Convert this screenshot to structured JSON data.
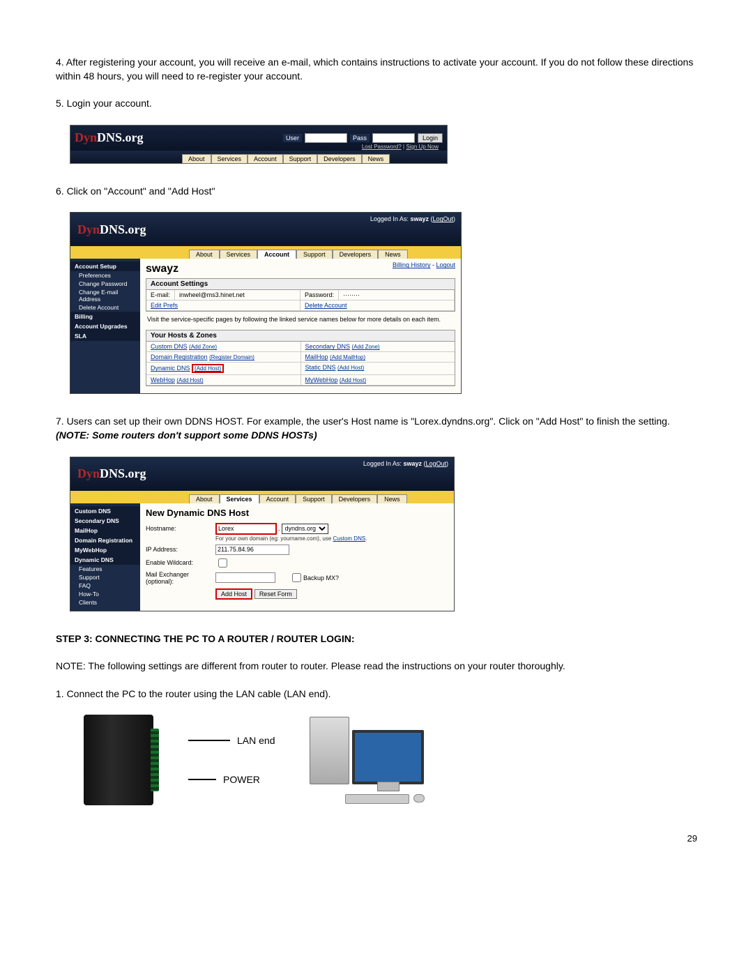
{
  "instructions": {
    "step4": "4. After registering your account, you will receive an e-mail, which contains instructions to activate your account. If you do not follow these directions within 48 hours, you will need to re-register your account.",
    "step5": "5. Login your account.",
    "step6": "6. Click on \"Account\" and \"Add Host\"",
    "step7_a": "7. Users can set up their own DDNS HOST. For example, the user's Host name is \"Lorex.dyndns.org\". Click on \"Add Host\"  to finish the setting. ",
    "step7_note": "(NOTE: Some  routers don't support some DDNS HOSTs)",
    "step3_heading": "STEP 3: CONNECTING THE PC TO A ROUTER / ROUTER LOGIN:",
    "step3_note": "NOTE: The following settings are different from router to router.  Please read the instructions on your router thoroughly.",
    "step3_1": "1. Connect the PC to the router using the LAN cable (LAN end)."
  },
  "logo": {
    "prefix": "Dyn",
    "suffix": "DNS.org"
  },
  "nav_tabs": [
    "About",
    "Services",
    "Account",
    "Support",
    "Developers",
    "News"
  ],
  "shot1": {
    "user_label": "User",
    "pass_label": "Pass",
    "login_btn": "Login",
    "lost_pw": "Lost Password?",
    "signup": "Sign Up Now"
  },
  "shot2": {
    "status_prefix": "Logged In As: ",
    "status_user": "swayz",
    "logout": "LogOut",
    "username_h": "swayz",
    "billing_history": "Billing History",
    "logout2": "Logout",
    "acct_settings": "Account Settings",
    "email_label": "E-mail:",
    "email_value": "inwheel@ms3.hinet.net",
    "password_label": "Password:",
    "password_value": "········",
    "edit_prefs": "Edit Prefs",
    "delete_account": "Delete Account",
    "visit_note": "Visit the service-specific pages by following the linked service names below for more details on each item.",
    "hosts_title": "Your Hosts & Zones",
    "rows": [
      {
        "l_link": "Custom DNS",
        "l_paren": "(Add Zone)",
        "r_link": "Secondary DNS",
        "r_paren": "(Add Zone)"
      },
      {
        "l_link": "Domain Registration",
        "l_paren": "(Register Domain)",
        "r_link": "MailHop",
        "r_paren": "(Add MailHop)"
      },
      {
        "l_link": "Dynamic DNS",
        "l_paren": "(Add Host)",
        "r_link": "Static DNS",
        "r_paren": "(Add Host)"
      },
      {
        "l_link": "WebHop",
        "l_paren": "(Add Host)",
        "r_link": "MyWebHop",
        "r_paren": "(Add Host)"
      }
    ],
    "sidebar": {
      "s1": "Account Setup",
      "i1": "Preferences",
      "i2": "Change Password",
      "i3": "Change E-mail Address",
      "i4": "Delete Account",
      "s2": "Billing",
      "s3": "Account Upgrades",
      "s4": "SLA"
    }
  },
  "shot3": {
    "status_prefix": "Logged In As: ",
    "status_user": "swayz",
    "logout": "LogOut",
    "title": "New Dynamic DNS Host",
    "hostname_l": "Hostname:",
    "hostname_v": "Lorex",
    "domain_v": "dyndns.org",
    "domain_note": "For your own domain (eg: yourname.com), use ",
    "domain_note_link": "Custom DNS",
    "ip_l": "IP Address:",
    "ip_v": "211.75.84.96",
    "wildcard_l": "Enable Wildcard:",
    "mx_l": "Mail Exchanger (optional):",
    "backup_mx": "Backup MX?",
    "btn_add": "Add Host",
    "btn_reset": "Reset Form",
    "sidebar": {
      "i1": "Custom DNS",
      "i2": "Secondary DNS",
      "i3": "MailHop",
      "i4": "Domain Registration",
      "i5": "MyWebHop",
      "s1": "Dynamic DNS",
      "i6": "Features",
      "i7": "Support",
      "i8": "FAQ",
      "i9": "How-To",
      "i10": "Clients"
    }
  },
  "diagram": {
    "lan": "LAN end",
    "power": "POWER"
  },
  "page_number": "29"
}
